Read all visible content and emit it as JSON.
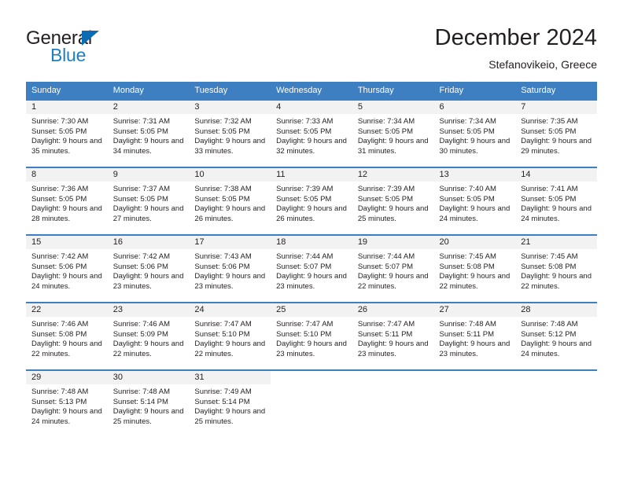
{
  "brand": {
    "name_part1": "General",
    "name_part2": "Blue",
    "triangle_icon": "triangle-icon"
  },
  "header": {
    "month_title": "December 2024",
    "location": "Stefanovikeio, Greece"
  },
  "calendar": {
    "weekday_headers": [
      "Sunday",
      "Monday",
      "Tuesday",
      "Wednesday",
      "Thursday",
      "Friday",
      "Saturday"
    ],
    "accent_color": "#3d7fc1",
    "day_band_color": "#f2f2f2",
    "weeks": [
      [
        {
          "day": "1",
          "sunrise": "Sunrise: 7:30 AM",
          "sunset": "Sunset: 5:05 PM",
          "daylight": "Daylight: 9 hours and 35 minutes."
        },
        {
          "day": "2",
          "sunrise": "Sunrise: 7:31 AM",
          "sunset": "Sunset: 5:05 PM",
          "daylight": "Daylight: 9 hours and 34 minutes."
        },
        {
          "day": "3",
          "sunrise": "Sunrise: 7:32 AM",
          "sunset": "Sunset: 5:05 PM",
          "daylight": "Daylight: 9 hours and 33 minutes."
        },
        {
          "day": "4",
          "sunrise": "Sunrise: 7:33 AM",
          "sunset": "Sunset: 5:05 PM",
          "daylight": "Daylight: 9 hours and 32 minutes."
        },
        {
          "day": "5",
          "sunrise": "Sunrise: 7:34 AM",
          "sunset": "Sunset: 5:05 PM",
          "daylight": "Daylight: 9 hours and 31 minutes."
        },
        {
          "day": "6",
          "sunrise": "Sunrise: 7:34 AM",
          "sunset": "Sunset: 5:05 PM",
          "daylight": "Daylight: 9 hours and 30 minutes."
        },
        {
          "day": "7",
          "sunrise": "Sunrise: 7:35 AM",
          "sunset": "Sunset: 5:05 PM",
          "daylight": "Daylight: 9 hours and 29 minutes."
        }
      ],
      [
        {
          "day": "8",
          "sunrise": "Sunrise: 7:36 AM",
          "sunset": "Sunset: 5:05 PM",
          "daylight": "Daylight: 9 hours and 28 minutes."
        },
        {
          "day": "9",
          "sunrise": "Sunrise: 7:37 AM",
          "sunset": "Sunset: 5:05 PM",
          "daylight": "Daylight: 9 hours and 27 minutes."
        },
        {
          "day": "10",
          "sunrise": "Sunrise: 7:38 AM",
          "sunset": "Sunset: 5:05 PM",
          "daylight": "Daylight: 9 hours and 26 minutes."
        },
        {
          "day": "11",
          "sunrise": "Sunrise: 7:39 AM",
          "sunset": "Sunset: 5:05 PM",
          "daylight": "Daylight: 9 hours and 26 minutes."
        },
        {
          "day": "12",
          "sunrise": "Sunrise: 7:39 AM",
          "sunset": "Sunset: 5:05 PM",
          "daylight": "Daylight: 9 hours and 25 minutes."
        },
        {
          "day": "13",
          "sunrise": "Sunrise: 7:40 AM",
          "sunset": "Sunset: 5:05 PM",
          "daylight": "Daylight: 9 hours and 24 minutes."
        },
        {
          "day": "14",
          "sunrise": "Sunrise: 7:41 AM",
          "sunset": "Sunset: 5:05 PM",
          "daylight": "Daylight: 9 hours and 24 minutes."
        }
      ],
      [
        {
          "day": "15",
          "sunrise": "Sunrise: 7:42 AM",
          "sunset": "Sunset: 5:06 PM",
          "daylight": "Daylight: 9 hours and 24 minutes."
        },
        {
          "day": "16",
          "sunrise": "Sunrise: 7:42 AM",
          "sunset": "Sunset: 5:06 PM",
          "daylight": "Daylight: 9 hours and 23 minutes."
        },
        {
          "day": "17",
          "sunrise": "Sunrise: 7:43 AM",
          "sunset": "Sunset: 5:06 PM",
          "daylight": "Daylight: 9 hours and 23 minutes."
        },
        {
          "day": "18",
          "sunrise": "Sunrise: 7:44 AM",
          "sunset": "Sunset: 5:07 PM",
          "daylight": "Daylight: 9 hours and 23 minutes."
        },
        {
          "day": "19",
          "sunrise": "Sunrise: 7:44 AM",
          "sunset": "Sunset: 5:07 PM",
          "daylight": "Daylight: 9 hours and 22 minutes."
        },
        {
          "day": "20",
          "sunrise": "Sunrise: 7:45 AM",
          "sunset": "Sunset: 5:08 PM",
          "daylight": "Daylight: 9 hours and 22 minutes."
        },
        {
          "day": "21",
          "sunrise": "Sunrise: 7:45 AM",
          "sunset": "Sunset: 5:08 PM",
          "daylight": "Daylight: 9 hours and 22 minutes."
        }
      ],
      [
        {
          "day": "22",
          "sunrise": "Sunrise: 7:46 AM",
          "sunset": "Sunset: 5:08 PM",
          "daylight": "Daylight: 9 hours and 22 minutes."
        },
        {
          "day": "23",
          "sunrise": "Sunrise: 7:46 AM",
          "sunset": "Sunset: 5:09 PM",
          "daylight": "Daylight: 9 hours and 22 minutes."
        },
        {
          "day": "24",
          "sunrise": "Sunrise: 7:47 AM",
          "sunset": "Sunset: 5:10 PM",
          "daylight": "Daylight: 9 hours and 22 minutes."
        },
        {
          "day": "25",
          "sunrise": "Sunrise: 7:47 AM",
          "sunset": "Sunset: 5:10 PM",
          "daylight": "Daylight: 9 hours and 23 minutes."
        },
        {
          "day": "26",
          "sunrise": "Sunrise: 7:47 AM",
          "sunset": "Sunset: 5:11 PM",
          "daylight": "Daylight: 9 hours and 23 minutes."
        },
        {
          "day": "27",
          "sunrise": "Sunrise: 7:48 AM",
          "sunset": "Sunset: 5:11 PM",
          "daylight": "Daylight: 9 hours and 23 minutes."
        },
        {
          "day": "28",
          "sunrise": "Sunrise: 7:48 AM",
          "sunset": "Sunset: 5:12 PM",
          "daylight": "Daylight: 9 hours and 24 minutes."
        }
      ],
      [
        {
          "day": "29",
          "sunrise": "Sunrise: 7:48 AM",
          "sunset": "Sunset: 5:13 PM",
          "daylight": "Daylight: 9 hours and 24 minutes."
        },
        {
          "day": "30",
          "sunrise": "Sunrise: 7:48 AM",
          "sunset": "Sunset: 5:14 PM",
          "daylight": "Daylight: 9 hours and 25 minutes."
        },
        {
          "day": "31",
          "sunrise": "Sunrise: 7:49 AM",
          "sunset": "Sunset: 5:14 PM",
          "daylight": "Daylight: 9 hours and 25 minutes."
        },
        {
          "day": "",
          "sunrise": "",
          "sunset": "",
          "daylight": ""
        },
        {
          "day": "",
          "sunrise": "",
          "sunset": "",
          "daylight": ""
        },
        {
          "day": "",
          "sunrise": "",
          "sunset": "",
          "daylight": ""
        },
        {
          "day": "",
          "sunrise": "",
          "sunset": "",
          "daylight": ""
        }
      ]
    ]
  }
}
